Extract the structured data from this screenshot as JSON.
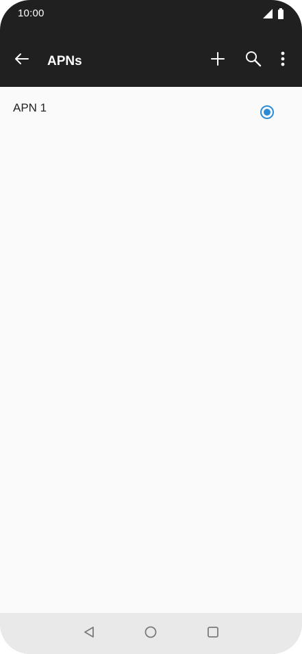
{
  "status_bar": {
    "time": "10:00",
    "icons": [
      "signal-icon",
      "battery-icon"
    ]
  },
  "app_bar": {
    "title": "APNs",
    "actions": [
      "back-arrow-icon",
      "add-icon",
      "search-icon",
      "more-vert-icon"
    ]
  },
  "apn_list": [
    {
      "name": "APN 1",
      "selected": true
    }
  ],
  "nav_bar": {
    "buttons": [
      "back-triangle-icon",
      "home-circle-icon",
      "recents-square-icon"
    ]
  },
  "colors": {
    "app_bar_bg": "#202020",
    "content_bg": "#fafafa",
    "accent": "#2a8bd6",
    "nav_bar_bg": "#e9e9e9"
  }
}
